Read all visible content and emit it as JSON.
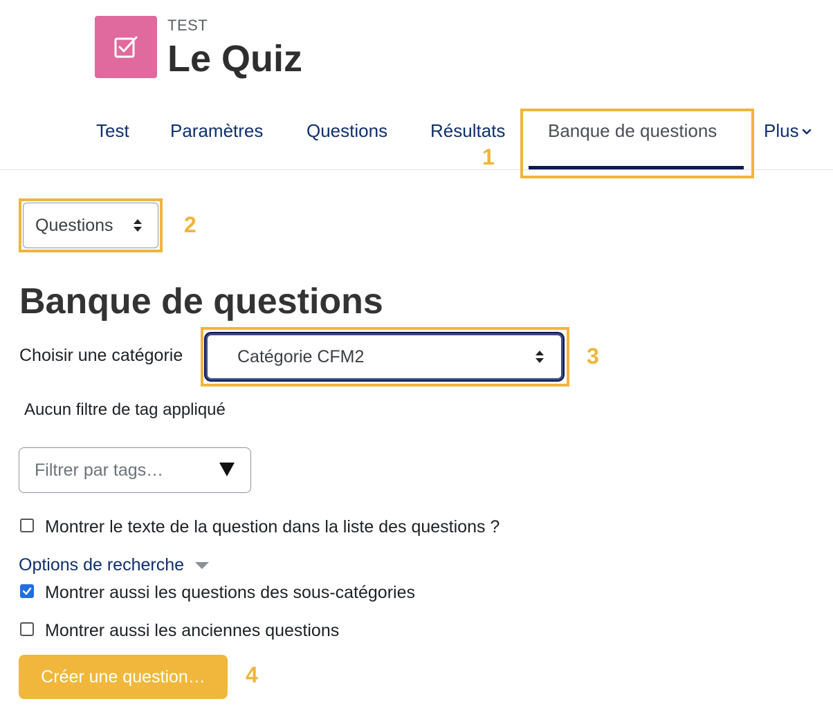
{
  "header": {
    "activity_type_label": "TEST",
    "page_heading": "Le Quiz",
    "icon": "checkbox-icon",
    "icon_color": "#e0699d"
  },
  "nav": {
    "tabs": [
      {
        "label": "Test"
      },
      {
        "label": "Paramètres"
      },
      {
        "label": "Questions"
      },
      {
        "label": "Résultats"
      },
      {
        "label": "Banque de questions",
        "active": true
      },
      {
        "label": "Plus"
      }
    ]
  },
  "annotations": {
    "a1": "1",
    "a2": "2",
    "a3": "3",
    "a4": "4",
    "color": "#efb53c"
  },
  "bank_nav_select": {
    "value": "Questions"
  },
  "main": {
    "title": "Banque de questions",
    "category_label": "Choisir une catégorie",
    "category_value": "Catégorie CFM2",
    "tag_filter_status": "Aucun filtre de tag appliqué",
    "tag_filter_placeholder": "Filtrer par tags…",
    "show_question_text": {
      "label": "Montrer le texte de la question dans la liste des questions ?",
      "checked": false
    },
    "search_options_label": "Options de recherche",
    "show_subcategories": {
      "label": "Montrer aussi les questions des sous-catégories",
      "checked": true
    },
    "show_old_questions": {
      "label": "Montrer aussi les anciennes questions",
      "checked": false
    },
    "create_button": "Créer une question…",
    "accent_color": "#f1b73c"
  }
}
